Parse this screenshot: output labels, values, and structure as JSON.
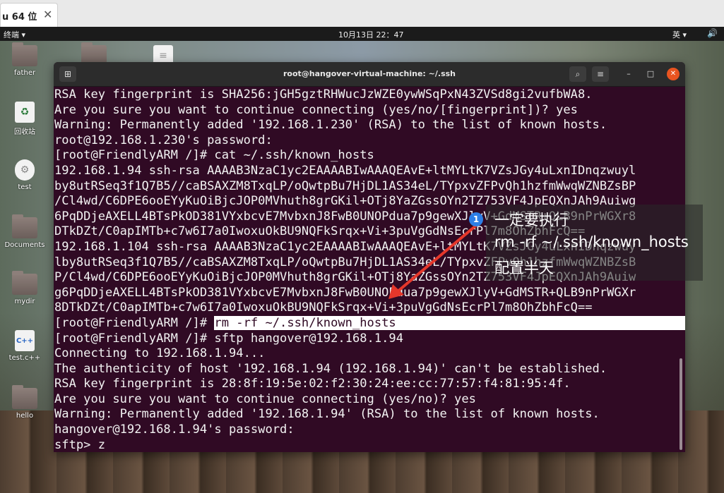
{
  "host_tab": {
    "label": "u 64 位",
    "close": "✕"
  },
  "topbar": {
    "app_menu": "终端 ▾",
    "clock": "10月13日  22：47",
    "lang": "英 ▾",
    "volume": "🔊 ▾"
  },
  "desktop_icons": [
    {
      "label": "father",
      "kind": "folder"
    },
    {
      "label": "回收站",
      "kind": "trash"
    },
    {
      "label": "test",
      "kind": "gear"
    },
    {
      "label": "Documents",
      "kind": "folder"
    },
    {
      "label": "mydir",
      "kind": "folder"
    },
    {
      "label": "test.c++",
      "kind": "cpp",
      "glyph": "C++"
    },
    {
      "label": "hello",
      "kind": "folder"
    }
  ],
  "terminal": {
    "title": "root@hangover-virtual-machine: ~/.ssh",
    "lines": [
      "RSA key fingerprint is SHA256:jGH5gztRHWucJzWZE0ywWSqPxN43ZVSd8gi2vufbWA8.",
      "Are you sure you want to continue connecting (yes/no/[fingerprint])? yes",
      "Warning: Permanently added '192.168.1.230' (RSA) to the list of known hosts.",
      "root@192.168.1.230's password:",
      "[root@FriendlyARM /]# cat ~/.ssh/known_hosts",
      "192.168.1.94 ssh-rsa AAAAB3NzaC1yc2EAAAABIwAAAQEAvE+ltMYLtK7VZsJGy4uLxnIDnqzwuyl",
      "by8utRSeq3f1Q7B5//caBSAXZM8TxqLP/oQwtpBu7HjDL1AS34eL/TYpxvZFPvQh1hzfmWwqWZNBZsBP",
      "/Cl4wd/C6DPE6ooEYyKuOiBjcJOP0MVhuth8grGKil+OTj8YaZGssOYn2TZ753VF4JpEQXnJAh9Auiwg",
      "6PqDDjeAXELL4BTsPkOD381VYxbcvE7MvbxnJ8FwB0UNOPdua7p9gewXJlyV+GdMSTR+QLB9nPrWGXr8",
      "DTkDZt/C0apIMTb+c7w6I7a0IwoxuOkBU9NQFkSrqx+Vi+3puVgGdNsEcrPl7m8OhZbhFcQ==",
      "192.168.1.104 ssh-rsa AAAAB3NzaC1yc2EAAAABIwAAAQEAvE+ltMYLtK7VZsJGy4uLxnIDnqzwuy",
      "lby8utRSeq3f1Q7B5//caBSAXZM8TxqLP/oQwtpBu7HjDL1AS34eL/TYpxvZFPvQh1hzfmWwqWZNBZsB",
      "P/Cl4wd/C6DPE6ooEYyKuOiBjcJOP0MVhuth8grGKil+OTj8YaZGssOYn2TZ753VF4JpEQXnJAh9Auiw",
      "g6PqDDjeAXELL4BTsPkOD381VYxbcvE7MvbxnJ8FwB0UNOPdua7p9gewXJlyV+GdMSTR+QLB9nPrWGXr",
      "8DTkDZt/C0apIMTb+c7w6I7a0IwoxuOkBU9NQFkSrqx+Vi+3puVgGdNsEcrPl7m8OhZbhFcQ==",
      "",
      "[root@FriendlyARM /]# sftp hangover@192.168.1.94",
      "Connecting to 192.168.1.94...",
      "The authenticity of host '192.168.1.94 (192.168.1.94)' can't be established.",
      "RSA key fingerprint is 28:8f:19:5e:02:f2:30:24:ee:cc:77:57:f4:81:95:4f.",
      "Are you sure you want to continue connecting (yes/no)? yes",
      "Warning: Permanently added '192.168.1.94' (RSA) to the list of known hosts.",
      "hangover@192.168.1.94's password:",
      "sftp> z"
    ],
    "highlight_prompt": "[root@FriendlyARM /]# ",
    "highlight_cmd": "rm -rf ~/.ssh/known_hosts                                          "
  },
  "annotation": {
    "badge": "1",
    "line1": "一定要执行",
    "line2": "rm -rf ~/.ssh/known_hosts",
    "line3": "配置半天",
    "arrow_color": "#e5372b"
  }
}
